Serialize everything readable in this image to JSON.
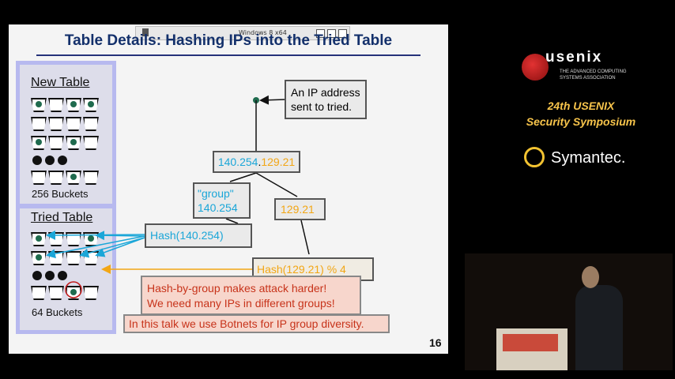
{
  "vm_bar": {
    "title": "Windows 8 x64"
  },
  "slide": {
    "title": "Table Details: Hashing IPs into the Tried Table",
    "new_table": {
      "title": "New Table",
      "caption": "256 Buckets"
    },
    "tried_table": {
      "title": "Tried Table",
      "caption": "64 Buckets"
    },
    "ip_note": "An IP address sent to tried.",
    "ip_group": "140.254",
    "ip_dot": ".",
    "ip_host": "129.21",
    "group_label": "\"group\"",
    "group_value": "140.254",
    "host_value": "129.21",
    "hash_group": "Hash(140.254)",
    "hash_host": "Hash(129.21) % 4",
    "callout_line1": "Hash-by-group makes attack harder!",
    "callout_line2": "We need many IPs in different groups!",
    "callout_botnet": "In this talk we use Botnets for IP group diversity.",
    "page_number": "16"
  },
  "sidebar": {
    "org_name": "usenix",
    "org_sub": "THE ADVANCED COMPUTING SYSTEMS ASSOCIATION",
    "conf_line1": "24th USENIX",
    "conf_line2": "Security Symposium",
    "sponsor": "Symantec."
  },
  "colors": {
    "accent_cyan": "#1aa6d8",
    "accent_orange": "#f2a615",
    "title_blue": "#13306b",
    "callout_red": "#c7331a"
  }
}
